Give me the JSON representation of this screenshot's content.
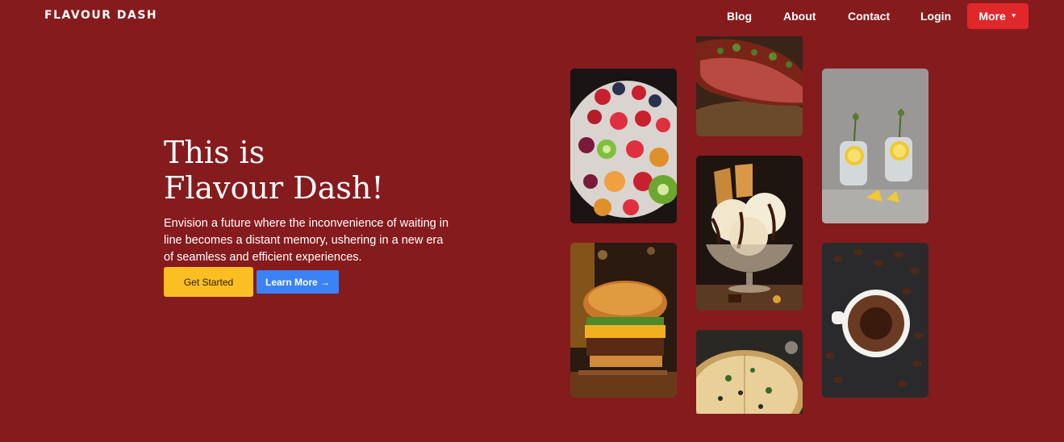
{
  "nav": {
    "brand": "FLAVOUR DASH",
    "links": [
      "Blog",
      "About",
      "Contact",
      "Login"
    ],
    "more_label": "More",
    "more_icon": "chevron-down-icon"
  },
  "hero": {
    "title_line1": "This is",
    "title_line2": "Flavour Dash!",
    "description": "Envision a future where the inconvenience of waiting in line becomes a distant memory, ushering in a new era of seamless and efficient experiences.",
    "primary_button": "Get Started",
    "secondary_button": "Learn More →"
  },
  "colors": {
    "background": "#861b1d",
    "more_button": "#e0282b",
    "get_started": "#fbbf24",
    "learn_more": "#3b82f6"
  }
}
